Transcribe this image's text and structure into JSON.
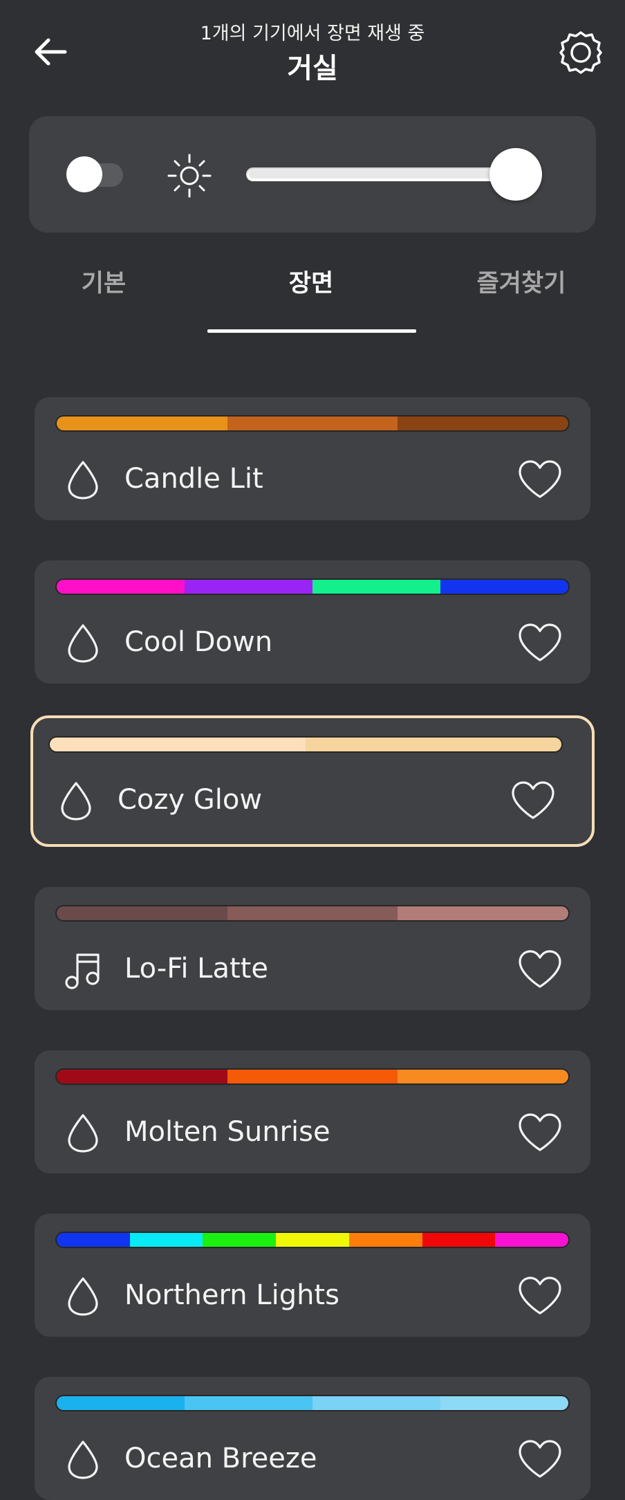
{
  "header": {
    "subtitle": "1개의 기기에서 장면 재생 중",
    "title": "거실",
    "back_icon": "arrow-left-icon",
    "settings_icon": "gear-icon"
  },
  "controls": {
    "power_on": false,
    "brightness_icon": "sun-icon",
    "brightness_level": 1.0
  },
  "tabs": [
    {
      "label": "기본",
      "active": false
    },
    {
      "label": "장면",
      "active": true
    },
    {
      "label": "즐겨찾기",
      "active": false
    }
  ],
  "scenes": [
    {
      "name": "Candle Lit",
      "icon": "drop-icon",
      "favorite": false,
      "selected": false,
      "colors": [
        "#e8921a",
        "#c4631c",
        "#8a4312"
      ]
    },
    {
      "name": "Cool Down",
      "icon": "drop-icon",
      "favorite": false,
      "selected": false,
      "colors": [
        "#ff10c8",
        "#9a24f5",
        "#12f08c",
        "#1234f0"
      ]
    },
    {
      "name": "Cozy Glow",
      "icon": "drop-icon",
      "favorite": false,
      "selected": true,
      "colors": [
        "#fde0bb",
        "#f5d49d"
      ]
    },
    {
      "name": "Lo-Fi Latte",
      "icon": "music-note-icon",
      "favorite": false,
      "selected": false,
      "colors": [
        "#6a4b49",
        "#875b57",
        "#b27c79"
      ]
    },
    {
      "name": "Molten Sunrise",
      "icon": "drop-icon",
      "favorite": false,
      "selected": false,
      "colors": [
        "#a00a18",
        "#f45a08",
        "#f88a22"
      ]
    },
    {
      "name": "Northern Lights",
      "icon": "drop-icon",
      "favorite": false,
      "selected": false,
      "colors": [
        "#1134f0",
        "#08eaf6",
        "#1cf012",
        "#f0f808",
        "#fb7e0c",
        "#f00808",
        "#f612d0"
      ]
    },
    {
      "name": "Ocean Breeze",
      "icon": "drop-icon",
      "favorite": false,
      "selected": false,
      "colors": [
        "#1ab2ee",
        "#4ac4f2",
        "#7ad2f4",
        "#8cdaf6"
      ]
    }
  ],
  "colors": {
    "background": "#2f3033",
    "card": "#404144",
    "selected_border": "#f7deb8",
    "inactive_tab": "#a8a8a8"
  }
}
